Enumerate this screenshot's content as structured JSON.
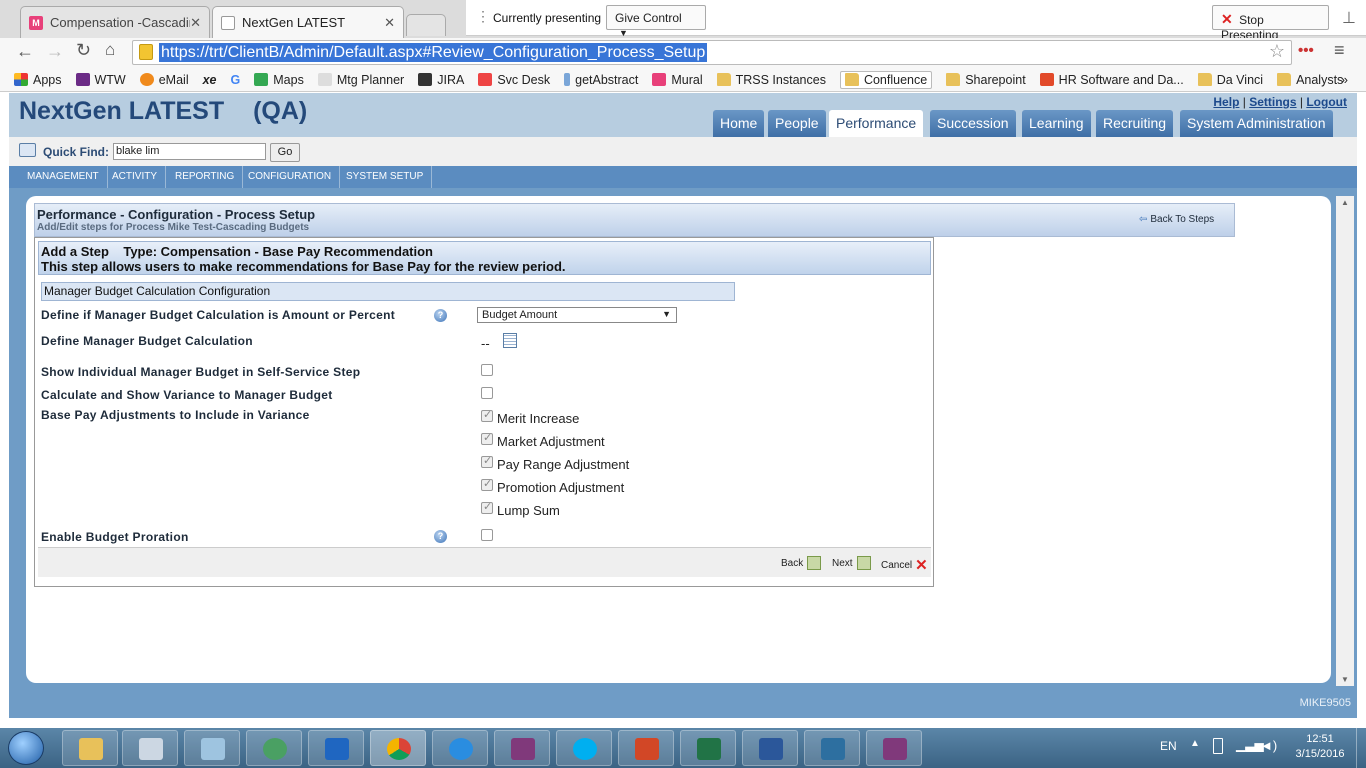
{
  "browser": {
    "tabs": [
      {
        "title": "Compensation -Cascading",
        "favicon": "M",
        "active": false
      },
      {
        "title": "NextGen LATEST",
        "favicon": "",
        "active": true
      }
    ],
    "url": "https://trt/ClientB/Admin/Default.aspx#Review_Configuration_Process_Setup",
    "presenting": {
      "label": "Currently presenting",
      "give_control": "Give Control",
      "stop": "Stop Presenting"
    },
    "bookmarks": [
      "Apps",
      "WTW",
      "eMail",
      "xe",
      "G",
      "Maps",
      "Mtg Planner",
      "JIRA",
      "Svc Desk",
      "getAbstract",
      "Mural",
      "TRSS Instances",
      "Confluence",
      "Sharepoint",
      "HR Software and Da...",
      "Da Vinci",
      "Analysts"
    ],
    "more": "»"
  },
  "app": {
    "title": "NextGen LATEST",
    "env": "(QA)",
    "links": [
      "Help",
      "Settings",
      "Logout"
    ],
    "nav": [
      "Home",
      "People",
      "Performance",
      "Succession",
      "Learning",
      "Recruiting",
      "System Administration"
    ],
    "nav_selected": "Performance",
    "quick_find": {
      "label": "Quick Find:",
      "value": "blake lim",
      "go": "Go"
    },
    "subnav": [
      "MANAGEMENT",
      "ACTIVITY",
      "REPORTING",
      "CONFIGURATION",
      "SYSTEM SETUP"
    ]
  },
  "page": {
    "title": "Performance - Configuration - Process Setup",
    "subtitle": "Add/Edit steps for Process Mike Test-Cascading Budgets",
    "back_to_steps": "Back To Steps",
    "step_title": "Add a Step    Type: Compensation - Base Pay Recommendation",
    "step_desc": "This step allows users to make recommendations for Base Pay for the review period.",
    "section": "Manager Budget Calculation Configuration",
    "fields": {
      "amount_or_percent_label": "Define if Manager Budget Calculation is Amount or Percent",
      "amount_or_percent_value": "Budget Amount",
      "define_calc_label": "Define Manager Budget Calculation",
      "define_calc_value": "--",
      "show_individual_label": "Show Individual Manager Budget in Self-Service Step",
      "show_individual_checked": false,
      "calc_variance_label": "Calculate and Show Variance to Manager Budget",
      "calc_variance_checked": false,
      "adjustments_label": "Base Pay Adjustments to Include in Variance",
      "adjustments": [
        {
          "label": "Merit Increase",
          "checked": true
        },
        {
          "label": "Market Adjustment",
          "checked": true
        },
        {
          "label": "Pay Range Adjustment",
          "checked": true
        },
        {
          "label": "Promotion Adjustment",
          "checked": true
        },
        {
          "label": "Lump Sum",
          "checked": true
        }
      ],
      "proration_label": "Enable Budget Proration",
      "proration_checked": false
    },
    "buttons": {
      "back": "Back",
      "next": "Next",
      "cancel": "Cancel"
    },
    "user": "MIKE9505"
  },
  "taskbar": {
    "lang": "EN",
    "time": "12:51",
    "date": "3/15/2016"
  }
}
